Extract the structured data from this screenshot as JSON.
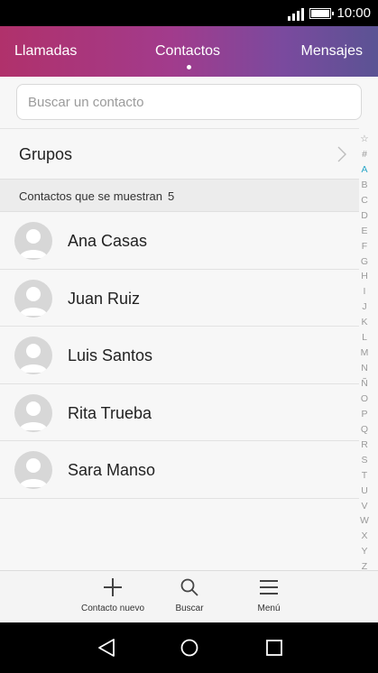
{
  "status_bar": {
    "time": "10:00",
    "icons": [
      "signal-icon",
      "battery-icon"
    ]
  },
  "tabs": [
    {
      "label": "Llamadas",
      "active": false
    },
    {
      "label": "Contactos",
      "active": true
    },
    {
      "label": "Mensajes",
      "active": false
    }
  ],
  "search": {
    "placeholder": "Buscar un contacto",
    "value": ""
  },
  "groups": {
    "label": "Grupos"
  },
  "section": {
    "label": "Contactos que se muestran",
    "count": "5"
  },
  "contacts": [
    {
      "name": "Ana Casas"
    },
    {
      "name": "Juan Ruiz"
    },
    {
      "name": "Luis Santos"
    },
    {
      "name": "Rita Trueba"
    },
    {
      "name": "Sara Manso"
    }
  ],
  "alphabet_index": [
    "☆",
    "#",
    "A",
    "B",
    "C",
    "D",
    "E",
    "F",
    "G",
    "H",
    "I",
    "J",
    "K",
    "L",
    "M",
    "N",
    "Ñ",
    "O",
    "P",
    "Q",
    "R",
    "S",
    "T",
    "U",
    "V",
    "W",
    "X",
    "Y",
    "Z"
  ],
  "alphabet_active": "A",
  "toolbar": {
    "new_contact_label": "Contacto nuevo",
    "search_label": "Buscar",
    "menu_label": "Menú"
  },
  "colors": {
    "accent": "#2aa6c8",
    "tab_gradient_start": "#b0316b",
    "tab_gradient_end": "#5b5394"
  }
}
